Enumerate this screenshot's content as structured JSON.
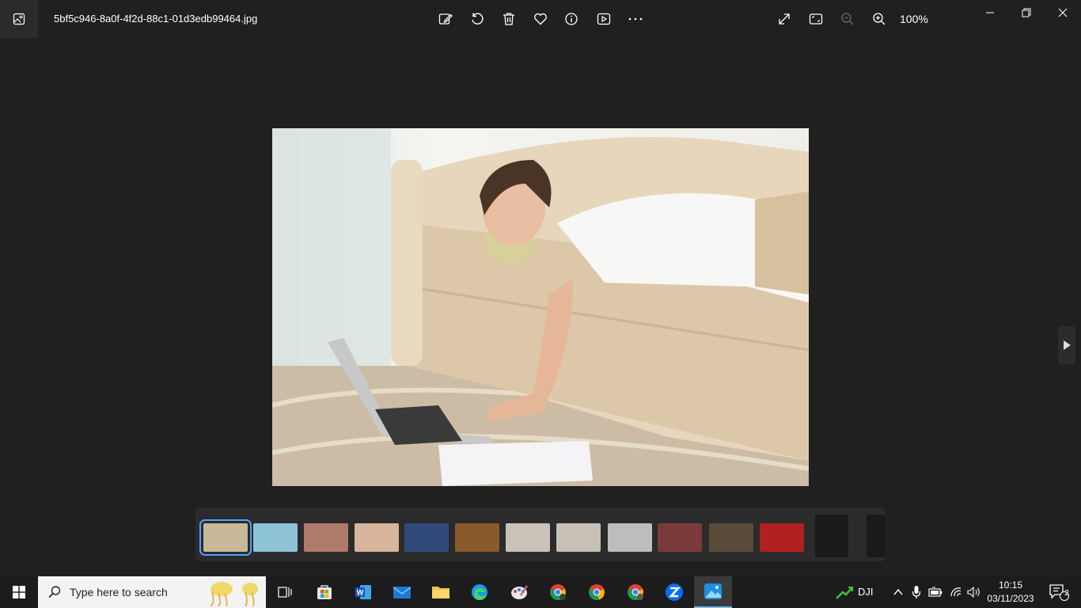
{
  "window": {
    "filename": "5bf5c946-8a0f-4f2d-88c1-01d3edb99464.jpg",
    "zoom": "100%"
  },
  "toolbar": {
    "icons": [
      "edit-image-icon",
      "rotate-icon",
      "delete-icon",
      "favorite-icon",
      "info-icon",
      "slideshow-icon",
      "more-icon"
    ],
    "view_icons": [
      "fullscreen-icon",
      "fit-to-window-icon",
      "zoom-out-icon",
      "zoom-in-icon"
    ]
  },
  "filmstrip": {
    "thumbnails": [
      {
        "name": "thumb-1",
        "color": "#c9b89a",
        "selected": true
      },
      {
        "name": "thumb-2",
        "color": "#8fc3d8"
      },
      {
        "name": "thumb-3",
        "color": "#b07a6a"
      },
      {
        "name": "thumb-4",
        "color": "#d6b59a"
      },
      {
        "name": "thumb-5",
        "color": "#2f4a7a"
      },
      {
        "name": "thumb-6",
        "color": "#8a5a2a"
      },
      {
        "name": "thumb-7",
        "color": "#c8c2b8"
      },
      {
        "name": "thumb-8",
        "color": "#c6c0b6"
      },
      {
        "name": "thumb-9",
        "color": "#bdbdbd"
      },
      {
        "name": "thumb-10",
        "color": "#7a3a3a"
      },
      {
        "name": "thumb-11",
        "color": "#5a4a3a"
      },
      {
        "name": "thumb-12",
        "color": "#b02020"
      },
      {
        "name": "thumb-13",
        "color": "#1a1a1a"
      },
      {
        "name": "thumb-14",
        "color": "#1a1a1a"
      }
    ]
  },
  "taskbar": {
    "search_placeholder": "Type here to search",
    "tray_app_label": "DJI",
    "time": "10:15",
    "date": "03/11/2023",
    "notification_count": "2"
  }
}
